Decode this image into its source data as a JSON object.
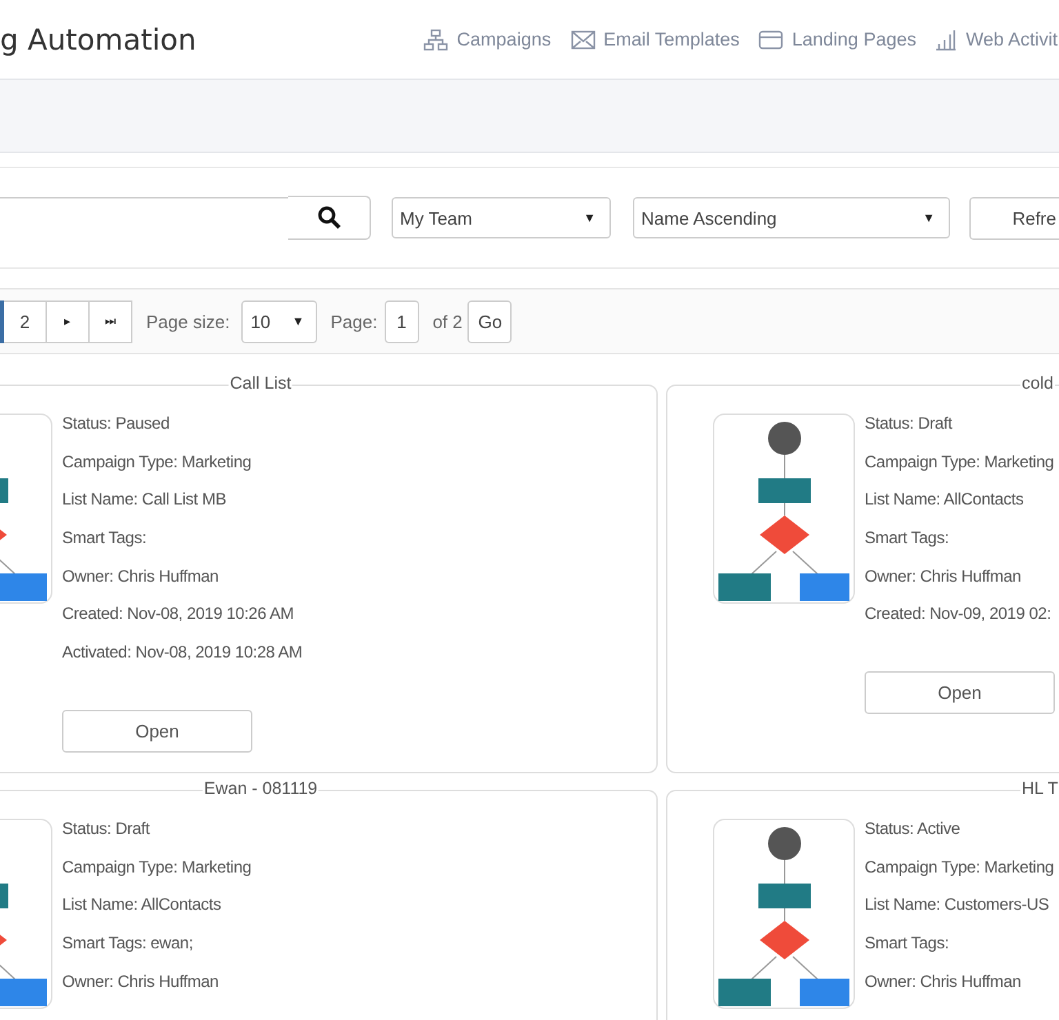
{
  "header": {
    "title": "g Automation",
    "nav": [
      {
        "label": "Campaigns"
      },
      {
        "label": "Email Templates"
      },
      {
        "label": "Landing Pages"
      },
      {
        "label": "Web Activit"
      }
    ]
  },
  "filters": {
    "team": "My Team",
    "team_caret": "▼",
    "sort": "Name Ascending",
    "sort_caret": "▼",
    "refresh": "Refre"
  },
  "pager": {
    "pages": [
      {
        "label": "2",
        "selected": false
      }
    ],
    "next": "▸",
    "last": "⏭",
    "page_size_label": "Page size:",
    "page_size": "10",
    "page_size_caret": "▼",
    "page_label": "Page:",
    "page": "1",
    "of": "of 2",
    "go": "Go"
  },
  "cards": [
    {
      "title": "Call List",
      "fields": [
        "Status: Paused",
        "Campaign Type: Marketing",
        "List Name: Call List MB",
        "Smart Tags:",
        "Owner: Chris Huffman",
        "Created: Nov-08, 2019 10:26 AM",
        "Activated: Nov-08, 2019 10:28 AM"
      ],
      "button": "Open"
    },
    {
      "title": "cold",
      "fields": [
        "Status: Draft",
        "Campaign Type: Marketing",
        "List Name: AllContacts",
        "Smart Tags:",
        "Owner: Chris Huffman",
        "Created: Nov-09, 2019 02:"
      ],
      "button": "Open"
    },
    {
      "title": "Ewan - 081119",
      "fields": [
        "Status: Draft",
        "Campaign Type: Marketing",
        "List Name: AllContacts",
        "Smart Tags: ewan;",
        "Owner: Chris Huffman"
      ]
    },
    {
      "title": "HL T",
      "fields": [
        "Status: Active",
        "Campaign Type: Marketing",
        "List Name: Customers-US",
        "Smart Tags:",
        "Owner: Chris Huffman"
      ]
    }
  ]
}
